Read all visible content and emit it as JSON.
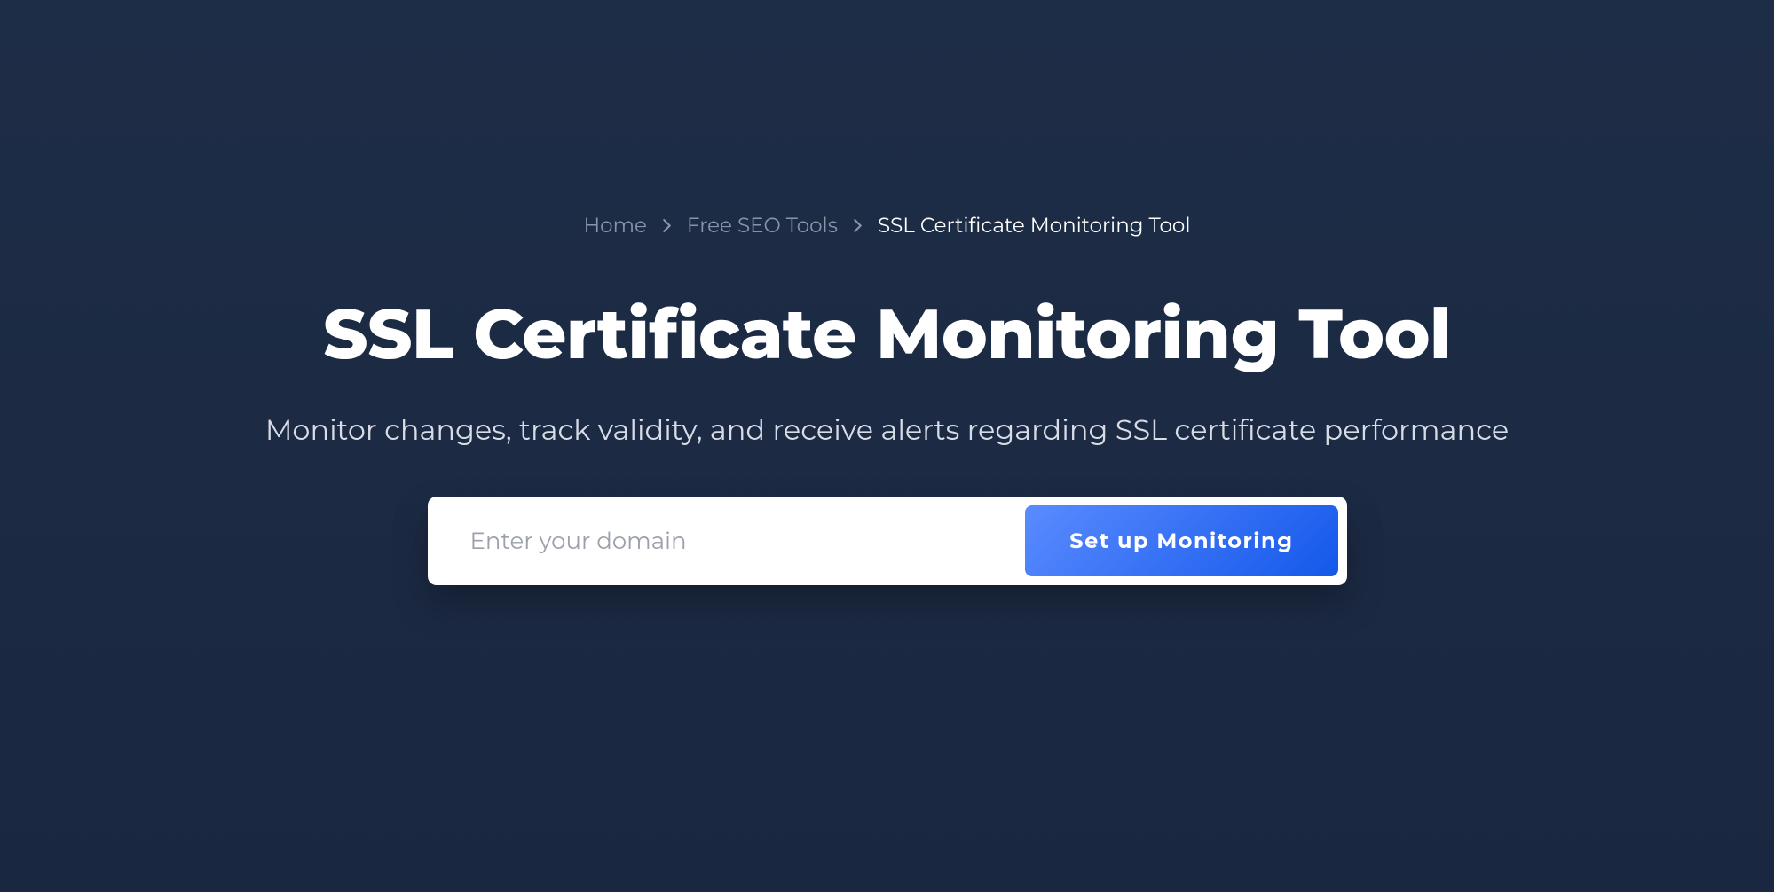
{
  "breadcrumb": {
    "items": [
      {
        "label": "Home",
        "link": true
      },
      {
        "label": "Free SEO Tools",
        "link": true
      },
      {
        "label": "SSL Certificate Monitoring Tool",
        "link": false
      }
    ]
  },
  "header": {
    "title": "SSL Certificate Monitoring Tool",
    "subtitle": "Monitor changes, track validity, and receive alerts regarding SSL certificate performance"
  },
  "form": {
    "domain_placeholder": "Enter your domain",
    "domain_value": "",
    "submit_label": "Set up Monitoring"
  }
}
